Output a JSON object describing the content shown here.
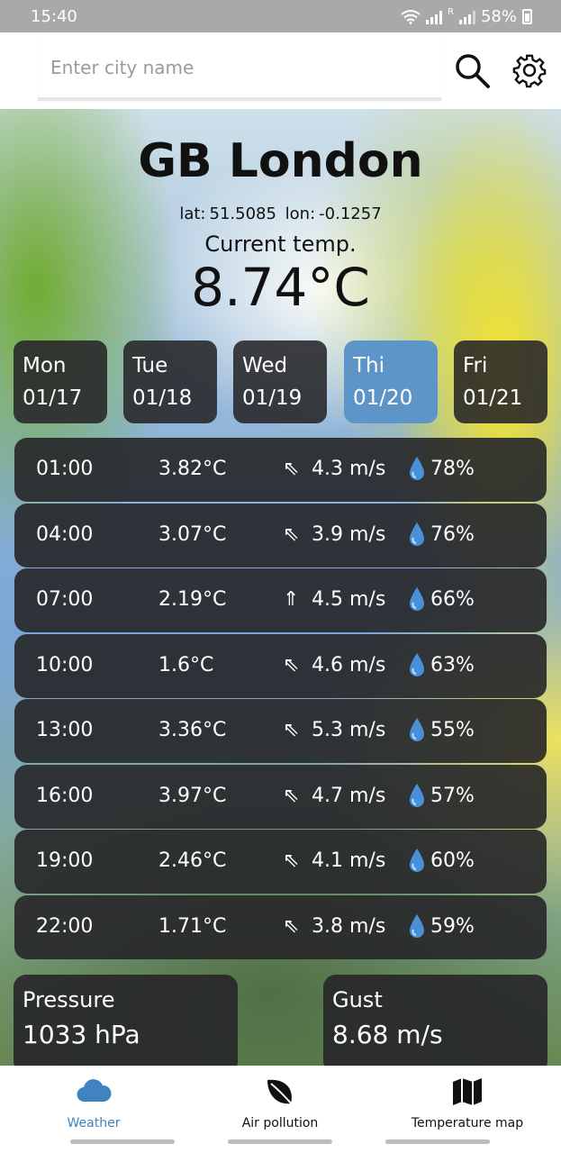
{
  "status": {
    "time": "15:40",
    "battery": "58%",
    "roaming": "R"
  },
  "search": {
    "placeholder": "Enter city name"
  },
  "weather": {
    "city": "GB London",
    "lat_label": "lat:",
    "lat": "51.5085",
    "lon_label": "lon:",
    "lon": "-0.1257",
    "current_label": "Current temp.",
    "current_temp": "8.74°C"
  },
  "days": [
    {
      "name": "Mon",
      "date": "01/17",
      "selected": false
    },
    {
      "name": "Tue",
      "date": "01/18",
      "selected": false
    },
    {
      "name": "Wed",
      "date": "01/19",
      "selected": false
    },
    {
      "name": "Thi",
      "date": "01/20",
      "selected": true
    },
    {
      "name": "Fri",
      "date": "01/21",
      "selected": false
    }
  ],
  "hourly": [
    {
      "time": "01:00",
      "temp": "3.82°C",
      "arrow": "⇖",
      "wind": "4.3 m/s",
      "humidity": "78%"
    },
    {
      "time": "04:00",
      "temp": "3.07°C",
      "arrow": "⇖",
      "wind": "3.9 m/s",
      "humidity": "76%"
    },
    {
      "time": "07:00",
      "temp": "2.19°C",
      "arrow": "⇑",
      "wind": "4.5 m/s",
      "humidity": "66%"
    },
    {
      "time": "10:00",
      "temp": "1.6°C",
      "arrow": "⇖",
      "wind": "4.6 m/s",
      "humidity": "63%"
    },
    {
      "time": "13:00",
      "temp": "3.36°C",
      "arrow": "⇖",
      "wind": "5.3 m/s",
      "humidity": "55%"
    },
    {
      "time": "16:00",
      "temp": "3.97°C",
      "arrow": "⇖",
      "wind": "4.7 m/s",
      "humidity": "57%"
    },
    {
      "time": "19:00",
      "temp": "2.46°C",
      "arrow": "⇖",
      "wind": "4.1 m/s",
      "humidity": "60%"
    },
    {
      "time": "22:00",
      "temp": "1.71°C",
      "arrow": "⇖",
      "wind": "3.8 m/s",
      "humidity": "59%"
    }
  ],
  "pressure": {
    "label": "Pressure",
    "value": "1033 hPa"
  },
  "gust": {
    "label": "Gust",
    "value": "8.68 m/s"
  },
  "nav": [
    {
      "label": "Weather",
      "icon": "cloud-icon",
      "active": true
    },
    {
      "label": "Air pollution",
      "icon": "leaf-icon",
      "active": false
    },
    {
      "label": "Temperature map",
      "icon": "map-icon",
      "active": false
    }
  ],
  "colors": {
    "accent": "#3f83c0",
    "selected_day": "#5d95c8",
    "card": "#262628",
    "drop": "#4a90d9"
  }
}
